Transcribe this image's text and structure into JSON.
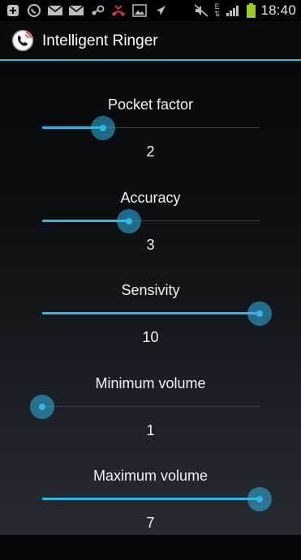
{
  "status_bar": {
    "time": "18:40",
    "network_label": "E",
    "icons": [
      "add-icon",
      "whatsapp-icon",
      "gmail-icon",
      "gmail-icon",
      "steam-icon",
      "missed-call-icon",
      "gallery-icon",
      "send-icon",
      "mute-icon",
      "network-icon",
      "signal-icon",
      "battery-icon"
    ]
  },
  "app": {
    "title": "Intelligent Ringer",
    "icon": "phone-ringer-icon"
  },
  "accent_color": "#33b5e5",
  "settings": [
    {
      "label": "Pocket factor",
      "value": "2",
      "fill_fraction": 0.28
    },
    {
      "label": "Accuracy",
      "value": "3",
      "fill_fraction": 0.4
    },
    {
      "label": "Sensivity",
      "value": "10",
      "fill_fraction": 1.0
    },
    {
      "label": "Minimum volume",
      "value": "1",
      "fill_fraction": 0.0
    },
    {
      "label": "Maximum volume",
      "value": "7",
      "fill_fraction": 1.0
    }
  ]
}
